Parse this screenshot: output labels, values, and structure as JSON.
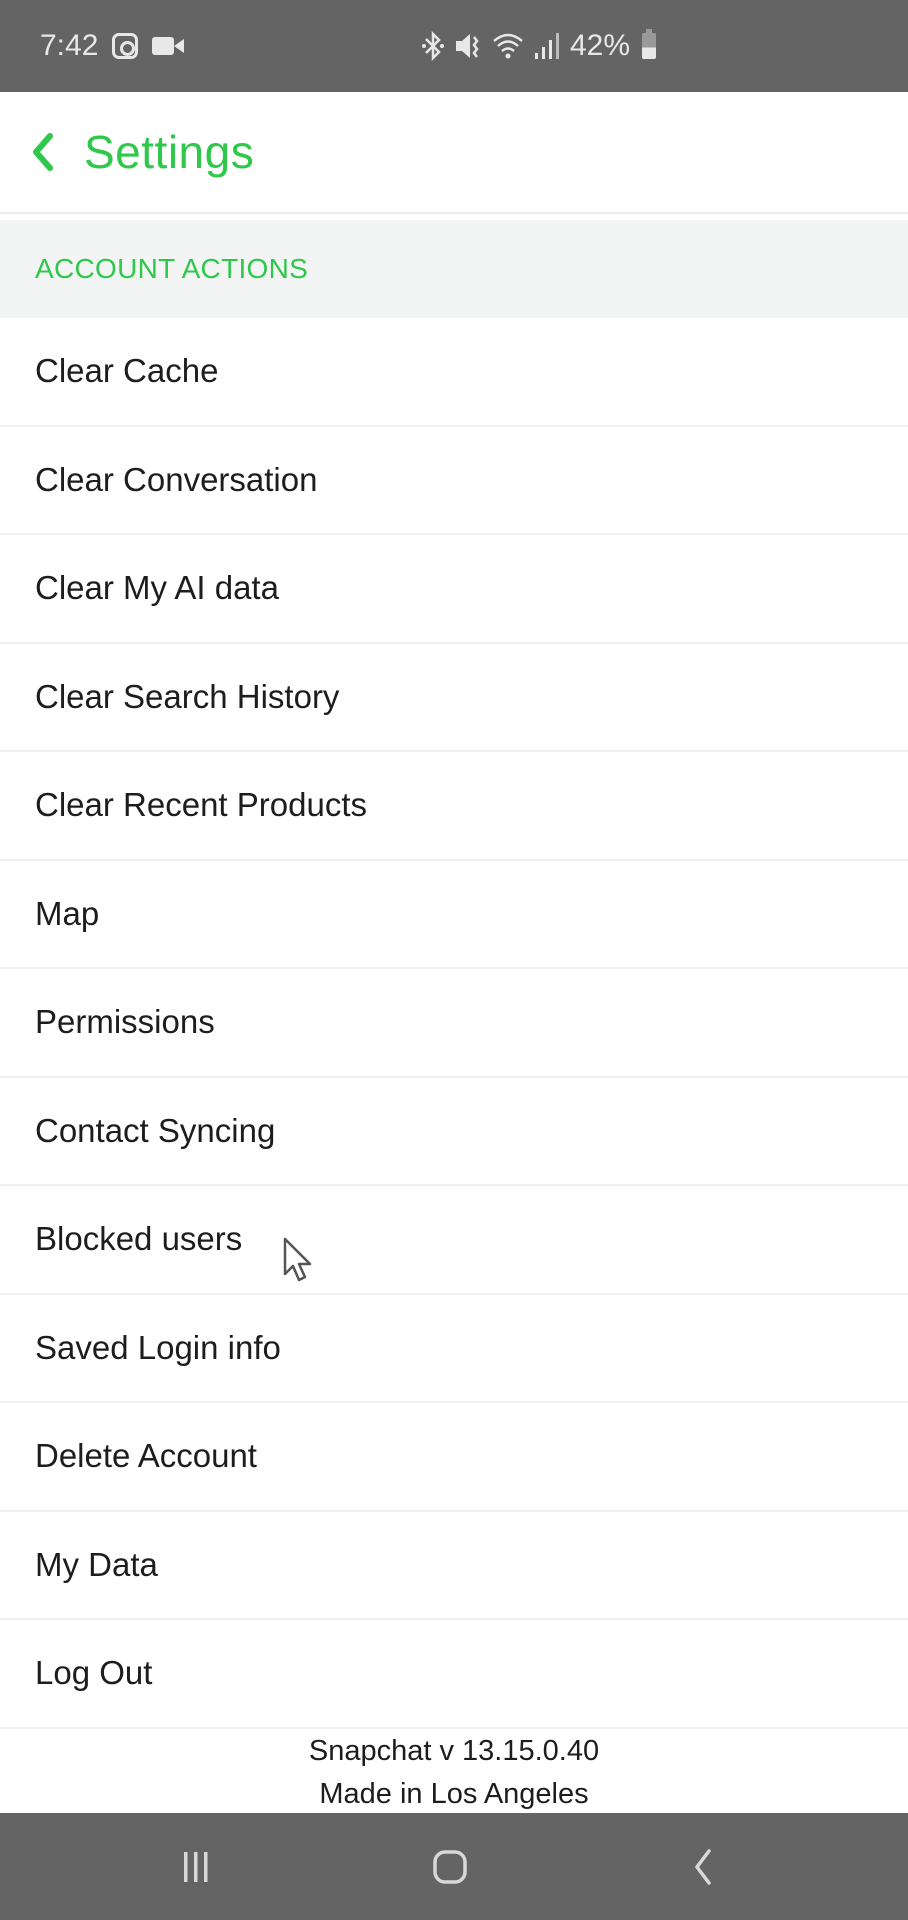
{
  "status_bar": {
    "time": "7:42",
    "left_icons": [
      "instagram-icon",
      "video-camera-icon"
    ],
    "right_icons": [
      "bluetooth-icon",
      "vibrate-mute-icon",
      "wifi-icon",
      "signal-icon",
      "battery-icon"
    ],
    "battery_percent": "42%"
  },
  "header": {
    "back_icon": "chevron-left-icon",
    "title": "Settings",
    "accent_color": "#2fc84b"
  },
  "section": {
    "label": "ACCOUNT ACTIONS"
  },
  "items": [
    {
      "label": "Clear Cache"
    },
    {
      "label": "Clear Conversation"
    },
    {
      "label": "Clear My AI data"
    },
    {
      "label": "Clear Search History"
    },
    {
      "label": "Clear Recent Products"
    },
    {
      "label": "Map"
    },
    {
      "label": "Permissions"
    },
    {
      "label": "Contact Syncing"
    },
    {
      "label": "Blocked users"
    },
    {
      "label": "Saved Login info"
    },
    {
      "label": "Delete Account"
    },
    {
      "label": "My Data"
    },
    {
      "label": "Log Out"
    }
  ],
  "footer": {
    "version": "Snapchat v 13.15.0.40",
    "made_in": "Made in Los Angeles"
  },
  "nav_bar": {
    "buttons": [
      "recents-icon",
      "home-icon",
      "back-icon"
    ]
  }
}
